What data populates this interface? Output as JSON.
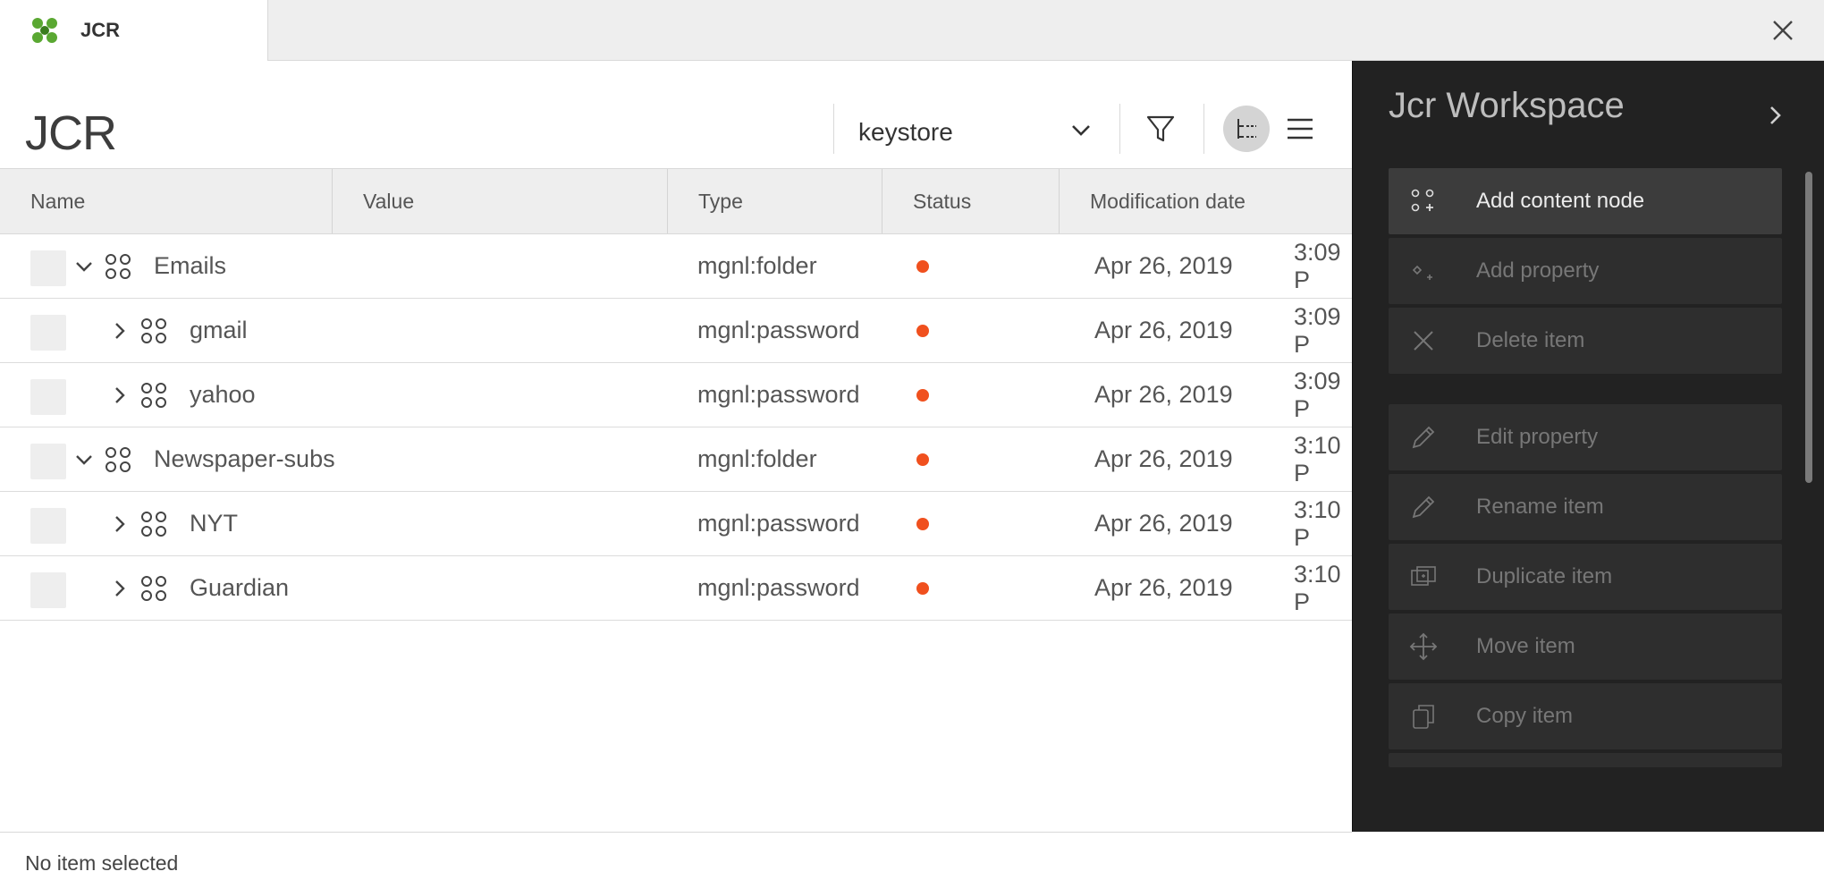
{
  "tab": {
    "label": "JCR",
    "icon": "app-logo-icon"
  },
  "header": {
    "title": "JCR",
    "workspace": "keystore"
  },
  "toolbar": {
    "filter_icon": "filter-icon",
    "tree_view_icon": "tree-view-icon",
    "list_view_icon": "list-view-icon"
  },
  "table": {
    "columns": [
      "Name",
      "Value",
      "Type",
      "Status",
      "Modification date"
    ],
    "rows": [
      {
        "name": "Emails",
        "level": 0,
        "expanded": true,
        "type": "mgnl:folder",
        "status": "modified",
        "date": "Apr 26, 2019",
        "time": "3:09 P"
      },
      {
        "name": "gmail",
        "level": 1,
        "expanded": false,
        "type": "mgnl:password",
        "status": "modified",
        "date": "Apr 26, 2019",
        "time": "3:09 P"
      },
      {
        "name": "yahoo",
        "level": 1,
        "expanded": false,
        "type": "mgnl:password",
        "status": "modified",
        "date": "Apr 26, 2019",
        "time": "3:09 P"
      },
      {
        "name": "Newspaper-subs",
        "level": 0,
        "expanded": true,
        "type": "mgnl:folder",
        "status": "modified",
        "date": "Apr 26, 2019",
        "time": "3:10 P"
      },
      {
        "name": "NYT",
        "level": 1,
        "expanded": false,
        "type": "mgnl:password",
        "status": "modified",
        "date": "Apr 26, 2019",
        "time": "3:10 P"
      },
      {
        "name": "Guardian",
        "level": 1,
        "expanded": false,
        "type": "mgnl:password",
        "status": "modified",
        "date": "Apr 26, 2019",
        "time": "3:10 P"
      }
    ]
  },
  "footer": {
    "status": "No item selected"
  },
  "panel": {
    "title": "Jcr Workspace",
    "actions": [
      {
        "label": "Add content node",
        "icon": "add-node-icon",
        "enabled": true
      },
      {
        "label": "Add property",
        "icon": "add-property-icon",
        "enabled": false
      },
      {
        "label": "Delete item",
        "icon": "delete-icon",
        "enabled": false
      },
      {
        "label": "Edit property",
        "icon": "pencil-icon",
        "enabled": false
      },
      {
        "label": "Rename item",
        "icon": "pencil-icon",
        "enabled": false
      },
      {
        "label": "Duplicate item",
        "icon": "duplicate-icon",
        "enabled": false
      },
      {
        "label": "Move item",
        "icon": "move-icon",
        "enabled": false
      },
      {
        "label": "Copy item",
        "icon": "copy-icon",
        "enabled": false
      }
    ]
  },
  "colors": {
    "status_dot": "#f0501e",
    "panel_bg": "#222222",
    "logo_green": "#5aa832"
  }
}
